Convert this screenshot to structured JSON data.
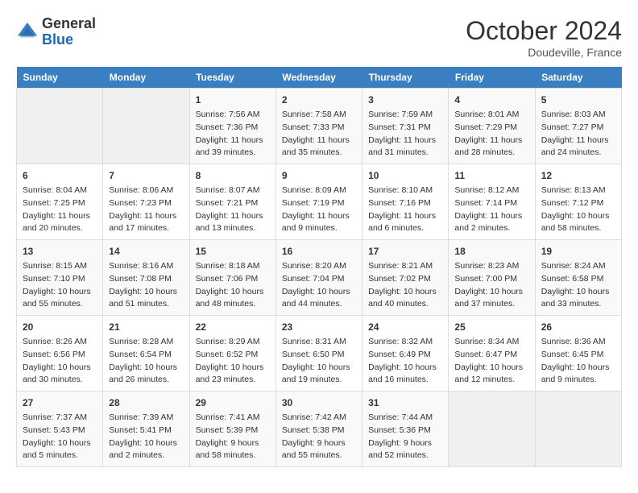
{
  "header": {
    "logo_general": "General",
    "logo_blue": "Blue",
    "month_title": "October 2024",
    "location": "Doudeville, France"
  },
  "days_of_week": [
    "Sunday",
    "Monday",
    "Tuesday",
    "Wednesday",
    "Thursday",
    "Friday",
    "Saturday"
  ],
  "weeks": [
    [
      {
        "day": "",
        "info": ""
      },
      {
        "day": "",
        "info": ""
      },
      {
        "day": "1",
        "info": "Sunrise: 7:56 AM\nSunset: 7:36 PM\nDaylight: 11 hours and 39 minutes."
      },
      {
        "day": "2",
        "info": "Sunrise: 7:58 AM\nSunset: 7:33 PM\nDaylight: 11 hours and 35 minutes."
      },
      {
        "day": "3",
        "info": "Sunrise: 7:59 AM\nSunset: 7:31 PM\nDaylight: 11 hours and 31 minutes."
      },
      {
        "day": "4",
        "info": "Sunrise: 8:01 AM\nSunset: 7:29 PM\nDaylight: 11 hours and 28 minutes."
      },
      {
        "day": "5",
        "info": "Sunrise: 8:03 AM\nSunset: 7:27 PM\nDaylight: 11 hours and 24 minutes."
      }
    ],
    [
      {
        "day": "6",
        "info": "Sunrise: 8:04 AM\nSunset: 7:25 PM\nDaylight: 11 hours and 20 minutes."
      },
      {
        "day": "7",
        "info": "Sunrise: 8:06 AM\nSunset: 7:23 PM\nDaylight: 11 hours and 17 minutes."
      },
      {
        "day": "8",
        "info": "Sunrise: 8:07 AM\nSunset: 7:21 PM\nDaylight: 11 hours and 13 minutes."
      },
      {
        "day": "9",
        "info": "Sunrise: 8:09 AM\nSunset: 7:19 PM\nDaylight: 11 hours and 9 minutes."
      },
      {
        "day": "10",
        "info": "Sunrise: 8:10 AM\nSunset: 7:16 PM\nDaylight: 11 hours and 6 minutes."
      },
      {
        "day": "11",
        "info": "Sunrise: 8:12 AM\nSunset: 7:14 PM\nDaylight: 11 hours and 2 minutes."
      },
      {
        "day": "12",
        "info": "Sunrise: 8:13 AM\nSunset: 7:12 PM\nDaylight: 10 hours and 58 minutes."
      }
    ],
    [
      {
        "day": "13",
        "info": "Sunrise: 8:15 AM\nSunset: 7:10 PM\nDaylight: 10 hours and 55 minutes."
      },
      {
        "day": "14",
        "info": "Sunrise: 8:16 AM\nSunset: 7:08 PM\nDaylight: 10 hours and 51 minutes."
      },
      {
        "day": "15",
        "info": "Sunrise: 8:18 AM\nSunset: 7:06 PM\nDaylight: 10 hours and 48 minutes."
      },
      {
        "day": "16",
        "info": "Sunrise: 8:20 AM\nSunset: 7:04 PM\nDaylight: 10 hours and 44 minutes."
      },
      {
        "day": "17",
        "info": "Sunrise: 8:21 AM\nSunset: 7:02 PM\nDaylight: 10 hours and 40 minutes."
      },
      {
        "day": "18",
        "info": "Sunrise: 8:23 AM\nSunset: 7:00 PM\nDaylight: 10 hours and 37 minutes."
      },
      {
        "day": "19",
        "info": "Sunrise: 8:24 AM\nSunset: 6:58 PM\nDaylight: 10 hours and 33 minutes."
      }
    ],
    [
      {
        "day": "20",
        "info": "Sunrise: 8:26 AM\nSunset: 6:56 PM\nDaylight: 10 hours and 30 minutes."
      },
      {
        "day": "21",
        "info": "Sunrise: 8:28 AM\nSunset: 6:54 PM\nDaylight: 10 hours and 26 minutes."
      },
      {
        "day": "22",
        "info": "Sunrise: 8:29 AM\nSunset: 6:52 PM\nDaylight: 10 hours and 23 minutes."
      },
      {
        "day": "23",
        "info": "Sunrise: 8:31 AM\nSunset: 6:50 PM\nDaylight: 10 hours and 19 minutes."
      },
      {
        "day": "24",
        "info": "Sunrise: 8:32 AM\nSunset: 6:49 PM\nDaylight: 10 hours and 16 minutes."
      },
      {
        "day": "25",
        "info": "Sunrise: 8:34 AM\nSunset: 6:47 PM\nDaylight: 10 hours and 12 minutes."
      },
      {
        "day": "26",
        "info": "Sunrise: 8:36 AM\nSunset: 6:45 PM\nDaylight: 10 hours and 9 minutes."
      }
    ],
    [
      {
        "day": "27",
        "info": "Sunrise: 7:37 AM\nSunset: 5:43 PM\nDaylight: 10 hours and 5 minutes."
      },
      {
        "day": "28",
        "info": "Sunrise: 7:39 AM\nSunset: 5:41 PM\nDaylight: 10 hours and 2 minutes."
      },
      {
        "day": "29",
        "info": "Sunrise: 7:41 AM\nSunset: 5:39 PM\nDaylight: 9 hours and 58 minutes."
      },
      {
        "day": "30",
        "info": "Sunrise: 7:42 AM\nSunset: 5:38 PM\nDaylight: 9 hours and 55 minutes."
      },
      {
        "day": "31",
        "info": "Sunrise: 7:44 AM\nSunset: 5:36 PM\nDaylight: 9 hours and 52 minutes."
      },
      {
        "day": "",
        "info": ""
      },
      {
        "day": "",
        "info": ""
      }
    ]
  ]
}
